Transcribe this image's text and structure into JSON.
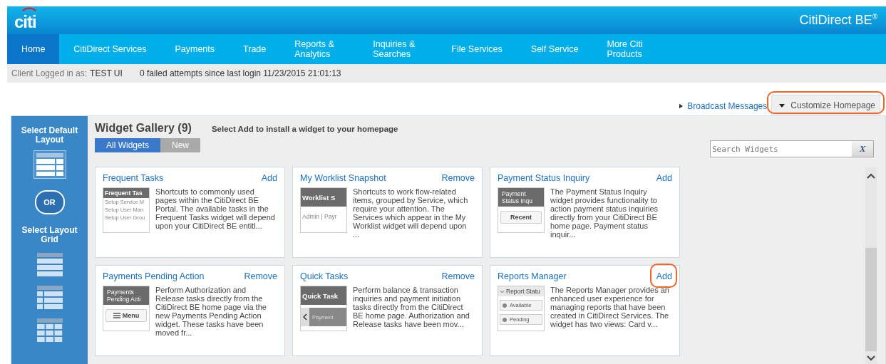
{
  "header": {
    "logo": "citi",
    "product": "CitiDirect BE",
    "product_mark": "®"
  },
  "nav": [
    {
      "label": "Home",
      "selected": true
    },
    {
      "label": "CitiDirect Services",
      "selected": false
    },
    {
      "label": "Payments",
      "selected": false
    },
    {
      "label": "Trade",
      "selected": false
    },
    {
      "label": "Reports & Analytics",
      "selected": false
    },
    {
      "label": "Inquiries & Searches",
      "selected": false
    },
    {
      "label": "File Services",
      "selected": false
    },
    {
      "label": "Self Service",
      "selected": false
    },
    {
      "label": "More Citi Products",
      "selected": false
    }
  ],
  "login_bar": {
    "label": "Client Logged in as:",
    "user": "TEST UI",
    "attempts": "0 failed attempts since last login 11/23/2015 21:01:13"
  },
  "links": {
    "broadcast": "Broadcast Messages",
    "customize": {
      "label": "Customize Homepage",
      "expanded": true,
      "highlighted": true
    }
  },
  "sidebar": {
    "default_title": "Select Default Layout",
    "or": "OR",
    "grid_title": "Select Layout Grid",
    "grids": [
      {
        "kind": "rows",
        "selected": false
      },
      {
        "kind": "split",
        "selected": false
      },
      {
        "kind": "cells",
        "selected": false
      }
    ]
  },
  "gallery": {
    "title": "Widget Gallery (9)",
    "hint": "Select Add to install a widget to your homepage",
    "filters": [
      {
        "label": "All Widgets",
        "selected": true
      },
      {
        "label": "New",
        "selected": false
      }
    ],
    "search": {
      "placeholder": "Search Widgets",
      "clear": "X"
    },
    "widgets": [
      {
        "title": "Frequent Tasks",
        "action": "Add",
        "highlighted": false,
        "description": "Shortcuts to commonly used pages within the CitiDirect BE Portal. The available tasks in the Frequent Tasks widget will depend upon your CitiDirect BE entitl...",
        "thumbnail": {
          "kind": "list",
          "header": "Frequent Tas",
          "items": [
            "Setup Service M",
            "Setup User Man",
            "Setup User Grou"
          ]
        }
      },
      {
        "title": "My Worklist Snapshot",
        "action": "Remove",
        "highlighted": false,
        "description": "Shortcuts to work flow-related items, grouped by Service, which require your attention. The Services which appear in the My Worklist widget will depend upon ...",
        "thumbnail": {
          "kind": "tabs",
          "header": "Worklist S",
          "items": [
            "Admin",
            "Payr"
          ]
        }
      },
      {
        "title": "Payment Status Inquiry",
        "action": "Add",
        "highlighted": false,
        "description": "The Payment Status Inquiry widget provides functionality to action payment status inquiries directly from your CitiDirect BE home page. Payment status inquir...",
        "thumbnail": {
          "kind": "button",
          "header": "Payment Status Inqu",
          "items": [
            "Recent"
          ]
        }
      },
      {
        "title": "Payments Pending Action",
        "action": "Remove",
        "highlighted": false,
        "description": "Perform Authorization and Release tasks directly from the CitiDirect BE home page via the new Payments Pending Action widget. These tasks have been moved fr...",
        "thumbnail": {
          "kind": "menu",
          "header": "Payments Pending Acti",
          "items": [
            "Menu"
          ]
        }
      },
      {
        "title": "Quick Tasks",
        "action": "Remove",
        "highlighted": false,
        "description": "Perform balance & transaction inquiries and payment initiation tasks directly from the CitiDirect BE home page. Authorization and Release tasks have been mov...",
        "thumbnail": {
          "kind": "pager",
          "header": "Quick Task",
          "items": [
            "Payment"
          ]
        }
      },
      {
        "title": "Reports Manager",
        "action": "Add",
        "highlighted": true,
        "description": "The Reports Manager provides an enhanced user experience for managing reports that have been created in CitiDirect Services. The widget has two views: Card v...",
        "thumbnail": {
          "kind": "status",
          "header": "Report Statu",
          "items": [
            "Available",
            "Pending"
          ]
        }
      }
    ]
  }
}
